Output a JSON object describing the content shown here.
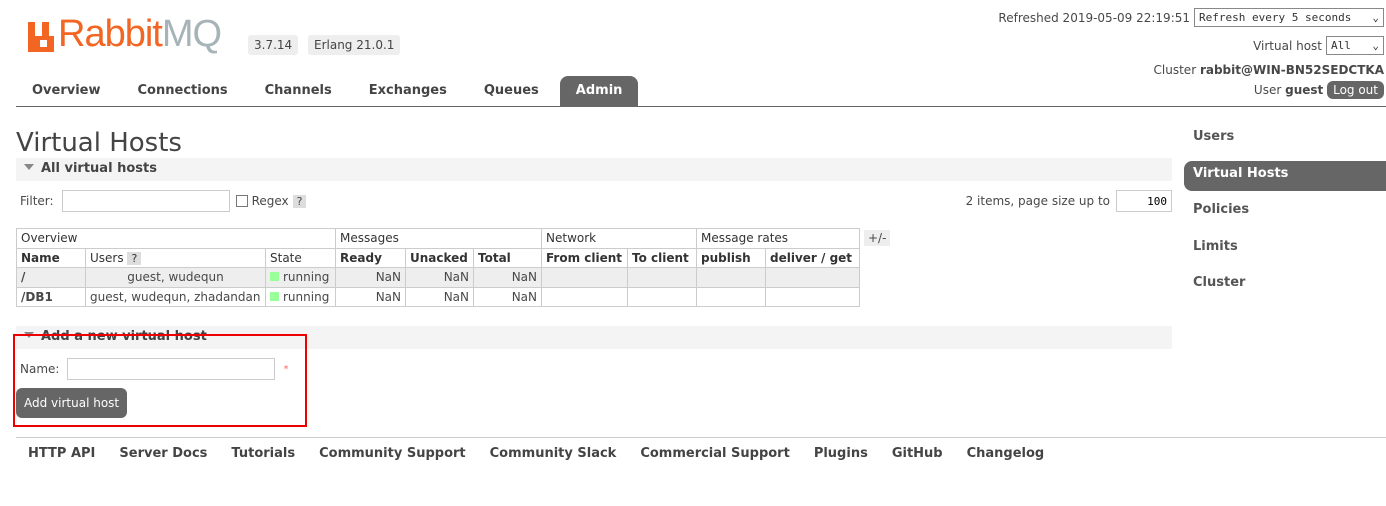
{
  "header": {
    "logo_text_1": "Rabbit",
    "logo_text_2": "MQ",
    "version": "3.7.14",
    "erlang": "Erlang 21.0.1",
    "refreshed": "Refreshed 2019-05-09 22:19:51",
    "refresh_select": "Refresh every 5 seconds",
    "vhost_label": "Virtual host",
    "vhost_select": "All",
    "cluster_label": "Cluster",
    "cluster": "rabbit@WIN-BN52SEDCTKA",
    "user_label": "User",
    "user": "guest",
    "logout": "Log out"
  },
  "tabs": [
    "Overview",
    "Connections",
    "Channels",
    "Exchanges",
    "Queues",
    "Admin"
  ],
  "sidebar": [
    "Users",
    "Virtual Hosts",
    "Policies",
    "Limits",
    "Cluster"
  ],
  "page_title": "Virtual Hosts",
  "all_section": {
    "title": "All virtual hosts",
    "filter_label": "Filter:",
    "regex_label": "Regex",
    "help": "?",
    "paging": "2 items, page size up to",
    "page_size": "100",
    "toggle": "+/-"
  },
  "table": {
    "groups": [
      "Overview",
      "Messages",
      "Network",
      "Message rates"
    ],
    "columns": [
      "Name",
      "Users",
      "State",
      "Ready",
      "Unacked",
      "Total",
      "From client",
      "To client",
      "publish",
      "deliver / get"
    ],
    "rows": [
      {
        "name": "/",
        "users": "guest, wudequn",
        "state": "running",
        "ready": "NaN",
        "unacked": "NaN",
        "total": "NaN"
      },
      {
        "name": "/DB1",
        "users": "guest, wudequn, zhadandan",
        "state": "running",
        "ready": "NaN",
        "unacked": "NaN",
        "total": "NaN"
      }
    ]
  },
  "add_section": {
    "title": "Add a new virtual host",
    "name_label": "Name:",
    "required": "*",
    "button": "Add virtual host"
  },
  "footer": [
    "HTTP API",
    "Server Docs",
    "Tutorials",
    "Community Support",
    "Community Slack",
    "Commercial Support",
    "Plugins",
    "GitHub",
    "Changelog"
  ],
  "colors": {
    "accent": "#f26522",
    "highlight": "#e00000",
    "running": "#99ff99"
  }
}
